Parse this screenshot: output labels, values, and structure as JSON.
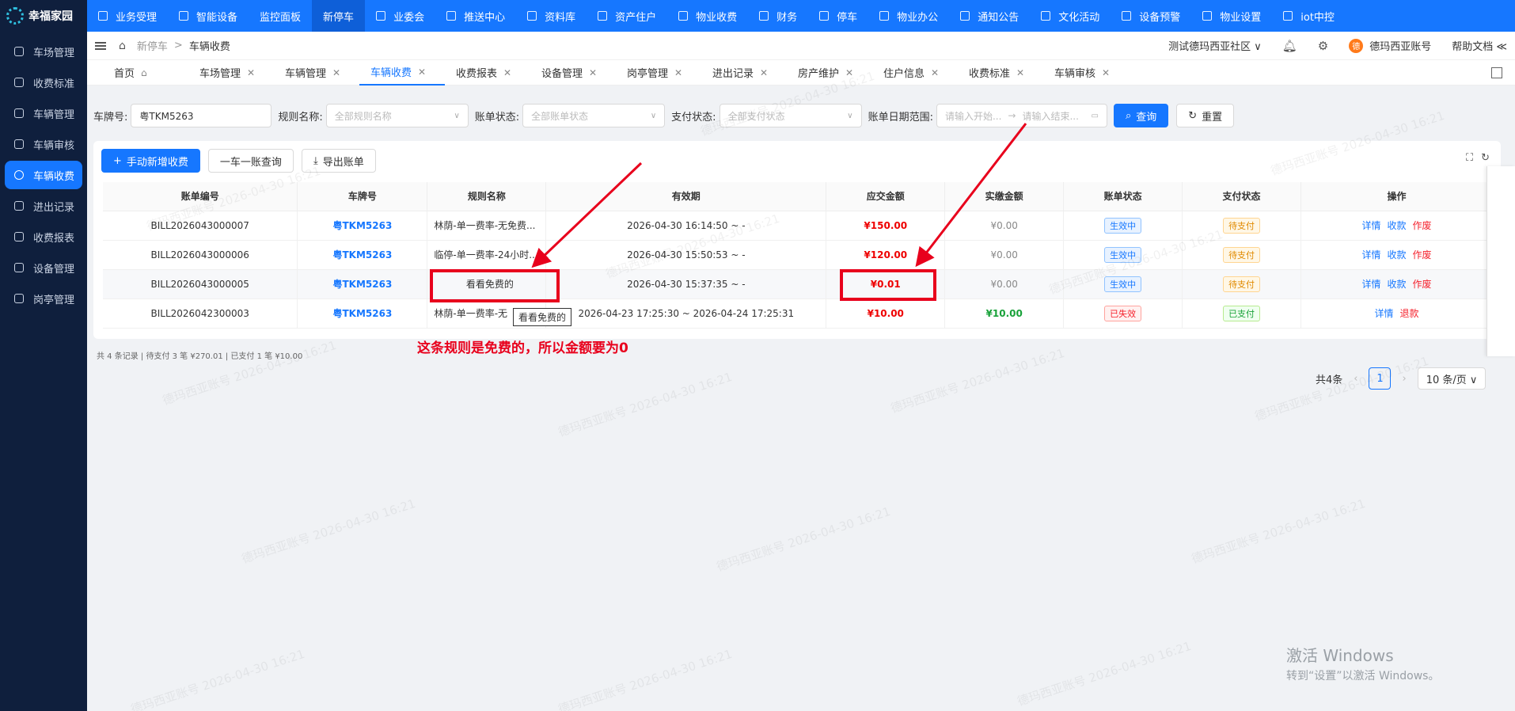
{
  "brand": "幸福家园",
  "topnav": [
    {
      "label": "业务受理",
      "name": "nav-business"
    },
    {
      "label": "智能设备",
      "name": "nav-smart-device"
    },
    {
      "label": "监控面板",
      "name": "nav-monitor"
    },
    {
      "label": "新停车",
      "name": "nav-new-parking"
    },
    {
      "label": "业委会",
      "name": "nav-committee"
    },
    {
      "label": "推送中心",
      "name": "nav-push"
    },
    {
      "label": "资料库",
      "name": "nav-library"
    },
    {
      "label": "资产住户",
      "name": "nav-assets"
    },
    {
      "label": "物业收费",
      "name": "nav-property-fee"
    },
    {
      "label": "财务",
      "name": "nav-finance"
    },
    {
      "label": "停车",
      "name": "nav-parking"
    },
    {
      "label": "物业办公",
      "name": "nav-office"
    },
    {
      "label": "通知公告",
      "name": "nav-notice"
    },
    {
      "label": "文化活动",
      "name": "nav-culture"
    },
    {
      "label": "设备预警",
      "name": "nav-alert"
    },
    {
      "label": "物业设置",
      "name": "nav-settings"
    },
    {
      "label": "iot中控",
      "name": "nav-iot"
    }
  ],
  "sidebar": [
    {
      "label": "车场管理",
      "name": "lot"
    },
    {
      "label": "收费标准",
      "name": "fee-standard"
    },
    {
      "label": "车辆管理",
      "name": "vehicle"
    },
    {
      "label": "车辆审核",
      "name": "vehicle-review"
    },
    {
      "label": "车辆收费",
      "name": "vehicle-fee"
    },
    {
      "label": "进出记录",
      "name": "access-log"
    },
    {
      "label": "收费报表",
      "name": "fee-report"
    },
    {
      "label": "设备管理",
      "name": "device"
    },
    {
      "label": "岗亭管理",
      "name": "booth"
    }
  ],
  "breadcrumb": {
    "parent": "新停车",
    "sep": ">",
    "current": "车辆收费"
  },
  "header": {
    "community": "测试德玛西亚社区 ∨",
    "account_avatar": "德",
    "account": "德玛西亚账号",
    "help": "帮助文档 ≪"
  },
  "tabs": [
    {
      "label": "首页",
      "close": "⌂"
    },
    {
      "label": "车场管理",
      "close": "✕"
    },
    {
      "label": "车辆管理",
      "close": "✕"
    },
    {
      "label": "车辆收费",
      "close": "✕"
    },
    {
      "label": "收费报表",
      "close": "✕"
    },
    {
      "label": "设备管理",
      "close": "✕"
    },
    {
      "label": "岗亭管理",
      "close": "✕"
    },
    {
      "label": "进出记录",
      "close": "✕"
    },
    {
      "label": "房产维护",
      "close": "✕"
    },
    {
      "label": "住户信息",
      "close": "✕"
    },
    {
      "label": "收费标准",
      "close": "✕"
    },
    {
      "label": "车辆审核",
      "close": "✕"
    }
  ],
  "filters": {
    "plate_label": "车牌号:",
    "plate_value": "粤TKM5263",
    "rule_label": "规则名称:",
    "rule_placeholder": "全部规则名称",
    "bill_status_label": "账单状态:",
    "bill_status_placeholder": "全部账单状态",
    "pay_status_label": "支付状态:",
    "pay_status_placeholder": "全部支付状态",
    "date_label": "账单日期范围:",
    "date_start_placeholder": "请输入开始...",
    "date_arrow": "→",
    "date_end_placeholder": "请输入结束...",
    "query": "查询",
    "reset": "重置"
  },
  "toolbar": {
    "add": "手动新增收费",
    "one_car": "一车一账查询",
    "export": "导出账单"
  },
  "table": {
    "headers": [
      "账单编号",
      "车牌号",
      "规则名称",
      "有效期",
      "应交金额",
      "实缴金额",
      "账单状态",
      "支付状态",
      "操作"
    ],
    "rows": [
      {
        "id": "BILL2026043000007",
        "plate": "粤TKM5263",
        "rule": "林荫-单一费率-无免费...",
        "period": "2026-04-30 16:14:50 ~ -",
        "due": "¥150.00",
        "paid": "¥0.00",
        "bill_status": "生效中",
        "pay_status": "待支付",
        "ops": [
          "详情",
          "收款",
          "作废"
        ]
      },
      {
        "id": "BILL2026043000006",
        "plate": "粤TKM5263",
        "rule": "临停-单一费率-24小时...",
        "period": "2026-04-30 15:50:53 ~ -",
        "due": "¥120.00",
        "paid": "¥0.00",
        "bill_status": "生效中",
        "pay_status": "待支付",
        "ops": [
          "详情",
          "收款",
          "作废"
        ]
      },
      {
        "id": "BILL2026043000005",
        "plate": "粤TKM5263",
        "rule": "看看免费的",
        "period": "2026-04-30 15:37:35 ~ -",
        "due": "¥0.01",
        "paid": "¥0.00",
        "bill_status": "生效中",
        "pay_status": "待支付",
        "ops": [
          "详情",
          "收款",
          "作废"
        ]
      },
      {
        "id": "BILL2026042300003",
        "plate": "粤TKM5263",
        "rule": "林荫-单一费率-无",
        "period": "2026-04-23 17:25:30 ~ 2026-04-24 17:25:31",
        "due": "¥10.00",
        "paid": "¥10.00",
        "bill_status": "已失效",
        "pay_status": "已支付",
        "ops": [
          "详情",
          "退款"
        ]
      }
    ]
  },
  "tooltip": "看看免费的",
  "summary": "共 4 条记录 | 待支付 3 笔 ¥270.01 | 已支付 1 笔 ¥10.00",
  "pager": {
    "total": "共4条",
    "page": "1",
    "size": "10 条/页 ∨"
  },
  "annotation": "这条规则是免费的，所以金额要为0",
  "watermark": "德玛西亚账号 2026-04-30 16:21",
  "windows": {
    "line1": "激活 Windows",
    "line2": "转到“设置”以激活 Windows。"
  },
  "colors": {
    "primary": "#1677ff",
    "sidebar": "#0f1f3d",
    "annotation": "#e8001c",
    "due": "#e00000"
  }
}
